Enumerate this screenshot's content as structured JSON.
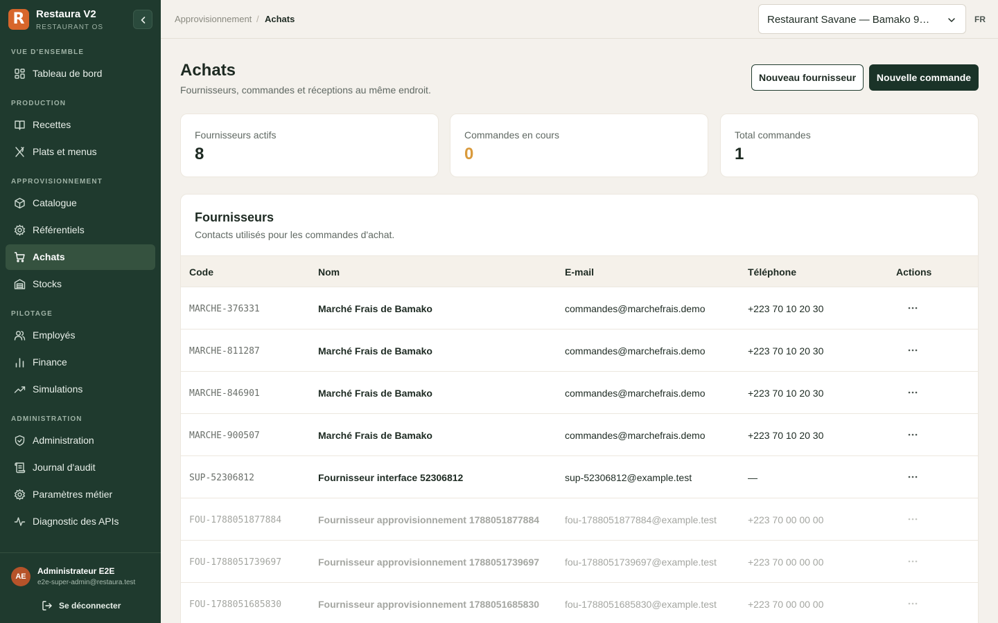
{
  "brand": {
    "logo_letter": "R",
    "name": "Restaura V2",
    "subtitle": "RESTAURANT OS"
  },
  "sidebar": {
    "sections": [
      {
        "title": "VUE D'ENSEMBLE"
      },
      {
        "title": "PRODUCTION"
      },
      {
        "title": "APPROVISIONNEMENT"
      },
      {
        "title": "PILOTAGE"
      },
      {
        "title": "ADMINISTRATION"
      }
    ],
    "items": [
      {
        "label": "Tableau de bord",
        "icon": "dashboard-icon"
      },
      {
        "label": "Recettes",
        "icon": "book-icon"
      },
      {
        "label": "Plats et menus",
        "icon": "utensils-icon"
      },
      {
        "label": "Catalogue",
        "icon": "package-icon"
      },
      {
        "label": "Référentiels",
        "icon": "gear-icon"
      },
      {
        "label": "Achats",
        "icon": "cart-icon",
        "active": true
      },
      {
        "label": "Stocks",
        "icon": "warehouse-icon"
      },
      {
        "label": "Employés",
        "icon": "users-icon"
      },
      {
        "label": "Finance",
        "icon": "bar-chart-icon"
      },
      {
        "label": "Simulations",
        "icon": "trend-icon"
      },
      {
        "label": "Administration",
        "icon": "shield-icon"
      },
      {
        "label": "Journal d'audit",
        "icon": "scroll-icon"
      },
      {
        "label": "Paramètres métier",
        "icon": "gear-icon"
      },
      {
        "label": "Diagnostic des APIs",
        "icon": "activity-icon"
      }
    ],
    "user": {
      "initials": "AE",
      "name": "Administrateur E2E",
      "email": "e2e-super-admin@restaura.test"
    },
    "logout_label": "Se déconnecter"
  },
  "topbar": {
    "breadcrumb": [
      "Approvisionnement",
      "Achats"
    ],
    "breadcrumb_sep": "/",
    "site": "Restaurant Savane — Bamako 9…",
    "lang": "FR"
  },
  "page": {
    "title": "Achats",
    "subtitle": "Fournisseurs, commandes et réceptions au même endroit.",
    "btn_new_supplier": "Nouveau fournisseur",
    "btn_new_order": "Nouvelle commande"
  },
  "stats": [
    {
      "label": "Fournisseurs actifs",
      "value": "8",
      "color": "#1d2a22"
    },
    {
      "label": "Commandes en cours",
      "value": "0",
      "color": "#d99a3c"
    },
    {
      "label": "Total commandes",
      "value": "1",
      "color": "#1d2a22"
    }
  ],
  "suppliers": {
    "title": "Fournisseurs",
    "subtitle": "Contacts utilisés pour les commandes d'achat.",
    "columns": [
      "Code",
      "Nom",
      "E-mail",
      "Téléphone",
      "Actions"
    ],
    "rows": [
      {
        "code": "MARCHE-376331",
        "name": "Marché Frais de Bamako",
        "email": "commandes@marchefrais.demo",
        "phone": "+223 70 10 20 30",
        "faded": false
      },
      {
        "code": "MARCHE-811287",
        "name": "Marché Frais de Bamako",
        "email": "commandes@marchefrais.demo",
        "phone": "+223 70 10 20 30",
        "faded": false
      },
      {
        "code": "MARCHE-846901",
        "name": "Marché Frais de Bamako",
        "email": "commandes@marchefrais.demo",
        "phone": "+223 70 10 20 30",
        "faded": false
      },
      {
        "code": "MARCHE-900507",
        "name": "Marché Frais de Bamako",
        "email": "commandes@marchefrais.demo",
        "phone": "+223 70 10 20 30",
        "faded": false
      },
      {
        "code": "SUP-52306812",
        "name": "Fournisseur interface 52306812",
        "email": "sup-52306812@example.test",
        "phone": "—",
        "faded": false
      },
      {
        "code": "FOU-1788051877884",
        "name": "Fournisseur approvisionnement 1788051877884",
        "email": "fou-1788051877884@example.test",
        "phone": "+223 70 00 00 00",
        "faded": true
      },
      {
        "code": "FOU-1788051739697",
        "name": "Fournisseur approvisionnement 1788051739697",
        "email": "fou-1788051739697@example.test",
        "phone": "+223 70 00 00 00",
        "faded": true
      },
      {
        "code": "FOU-1788051685830",
        "name": "Fournisseur approvisionnement 1788051685830",
        "email": "fou-1788051685830@example.test",
        "phone": "+223 70 00 00 00",
        "faded": true
      }
    ]
  },
  "colors": {
    "sidebar_bg": "#1f3a2e",
    "accent": "#d7662b",
    "primary_button": "#1a3328",
    "in_progress": "#d99a3c"
  }
}
